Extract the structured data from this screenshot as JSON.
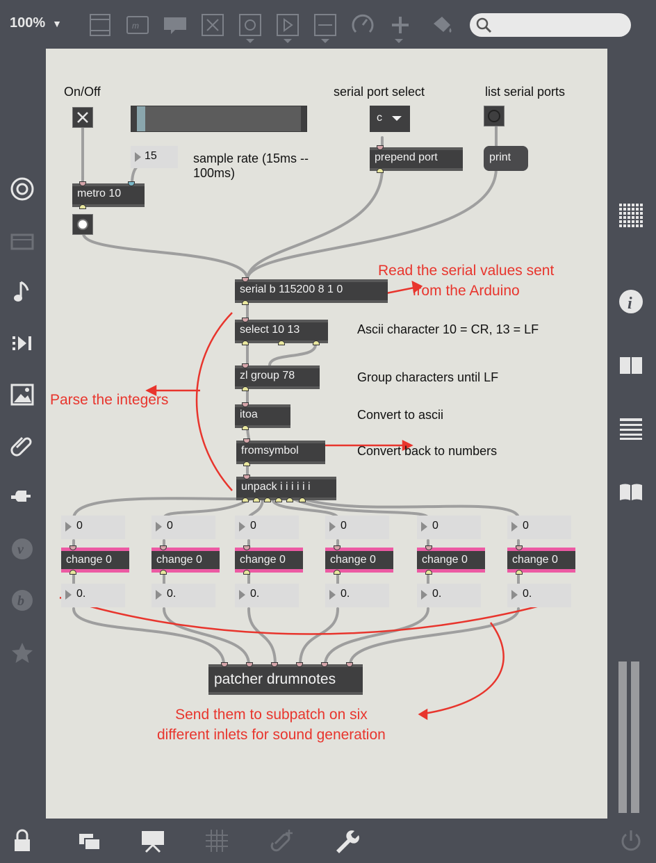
{
  "toolbar": {
    "zoom": "100%",
    "zoom_caret": "▼",
    "icons": [
      "patcher-list-icon",
      "comment-icon",
      "message-bubble-icon",
      "toggle-object-icon",
      "button-object-icon",
      "play-object-icon",
      "slider-object-icon",
      "dial-object-icon",
      "plus-icon",
      "paint-bucket-icon"
    ],
    "search_placeholder": ""
  },
  "left_sidebar": {
    "icons": [
      "target-icon",
      "device-icon",
      "music-note-icon",
      "media-play-icon",
      "image-icon",
      "paperclip-icon",
      "plug-icon",
      "v-circle-icon",
      "b-circle-icon",
      "star-icon"
    ]
  },
  "right_sidebar": {
    "icons": [
      "grid-icon",
      "info-icon",
      "book-columns-icon",
      "list-icon",
      "open-book-icon",
      "level-meter"
    ]
  },
  "bottom_bar": {
    "icons": [
      "lock-icon",
      "windows-icon",
      "presentation-icon",
      "grid-snap-icon",
      "attach-plus-icon",
      "wrench-icon",
      "power-icon"
    ]
  },
  "patch": {
    "labels": {
      "on_off": "On/Off",
      "serial_port_select": "serial port select",
      "list_serial_ports": "list serial ports",
      "sample_rate": "sample rate (15ms --\n100ms)",
      "ascii_note": "Ascii character 10 = CR, 13 = LF",
      "group_note": "Group characters until LF",
      "convert_ascii": "Convert to ascii",
      "convert_back": "Convert back to numbers"
    },
    "annotations": {
      "read_serial": "Read the serial values sent\nfrom the Arduino",
      "parse": "Parse the integers",
      "send": "Send them to subpatch on six\ndifferent inlets for sound generation"
    },
    "objects": {
      "metro": "metro 10",
      "number_15": "15",
      "umenu": "c",
      "prepend": "prepend port",
      "print": "print",
      "serial": "serial b 115200 8 1 0",
      "select": "select 10 13",
      "zl": "zl group 78",
      "itoa": "itoa",
      "fromsymbol": "fromsymbol",
      "unpack": "unpack i i i i i i",
      "patcher": "patcher drumnotes"
    },
    "channels": [
      {
        "input": "0",
        "change": "change 0",
        "output": "0."
      },
      {
        "input": "0",
        "change": "change 0",
        "output": "0."
      },
      {
        "input": "0",
        "change": "change 0",
        "output": "0."
      },
      {
        "input": "0",
        "change": "change 0",
        "output": "0."
      },
      {
        "input": "0",
        "change": "change 0",
        "output": "0."
      },
      {
        "input": "0",
        "change": "change 0",
        "output": "0."
      }
    ],
    "colors": {
      "accent_red": "#e8352d",
      "change_pink": "#ec5aa3",
      "canvas": "#e2e2dc",
      "object": "#3f3f40"
    }
  }
}
